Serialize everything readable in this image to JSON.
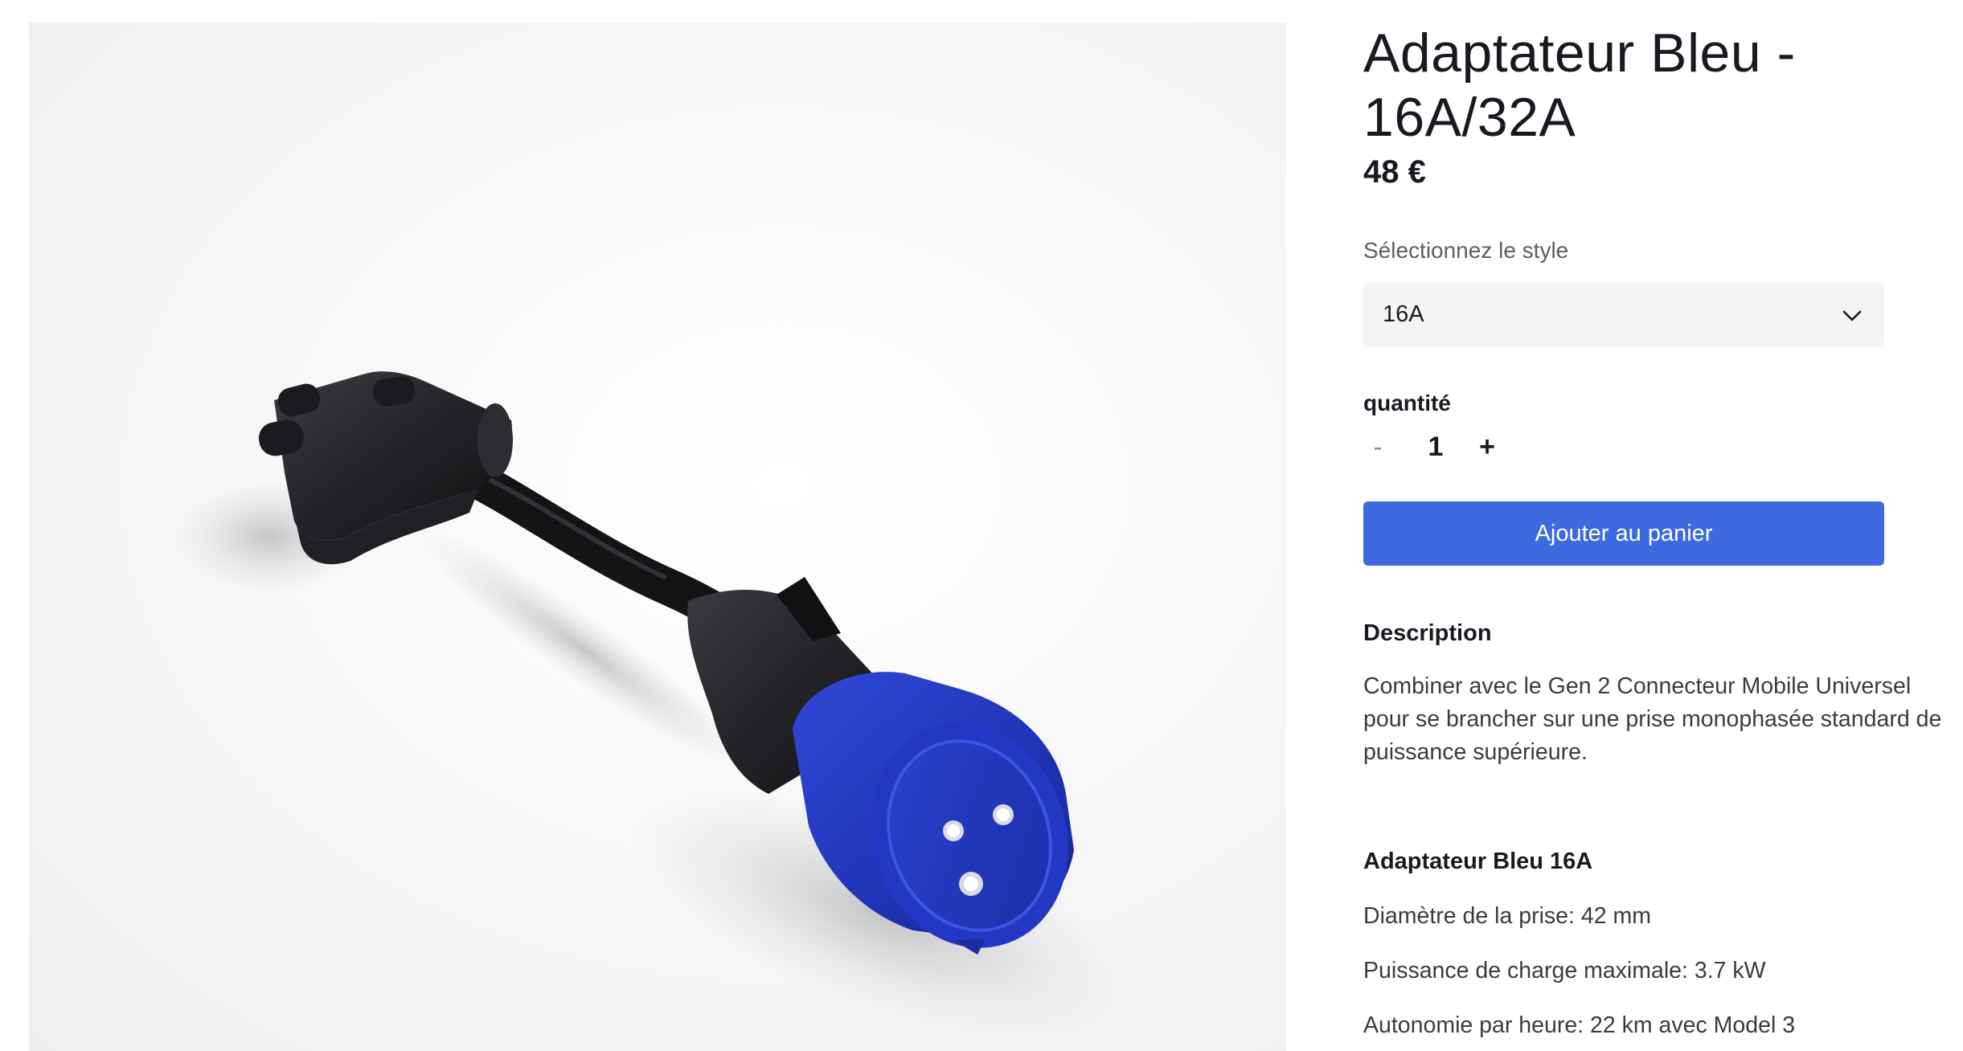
{
  "product": {
    "title": "Adaptateur Bleu - 16A/32A",
    "price": "48 €",
    "image_description": "blue-adapter-product-photo"
  },
  "style_selector": {
    "label": "Sélectionnez le style",
    "selected": "16A",
    "icon": "chevron-down-icon"
  },
  "quantity": {
    "label": "quantité",
    "decrement": "-",
    "value": "1",
    "increment": "+"
  },
  "cart": {
    "add_label": "Ajouter au panier",
    "button_color": "#3e6ae1"
  },
  "description": {
    "heading": "Description",
    "text": "Combiner avec le Gen 2 Connecteur Mobile Universel pour se brancher sur une prise monophasée standard de puissance supérieure."
  },
  "specs": {
    "heading": "Adaptateur Bleu 16A",
    "items": [
      "Diamètre de la prise: 42 mm",
      "Puissance de charge maximale: 3.7 kW",
      "Autonomie par heure: 22 km avec Model 3"
    ]
  }
}
